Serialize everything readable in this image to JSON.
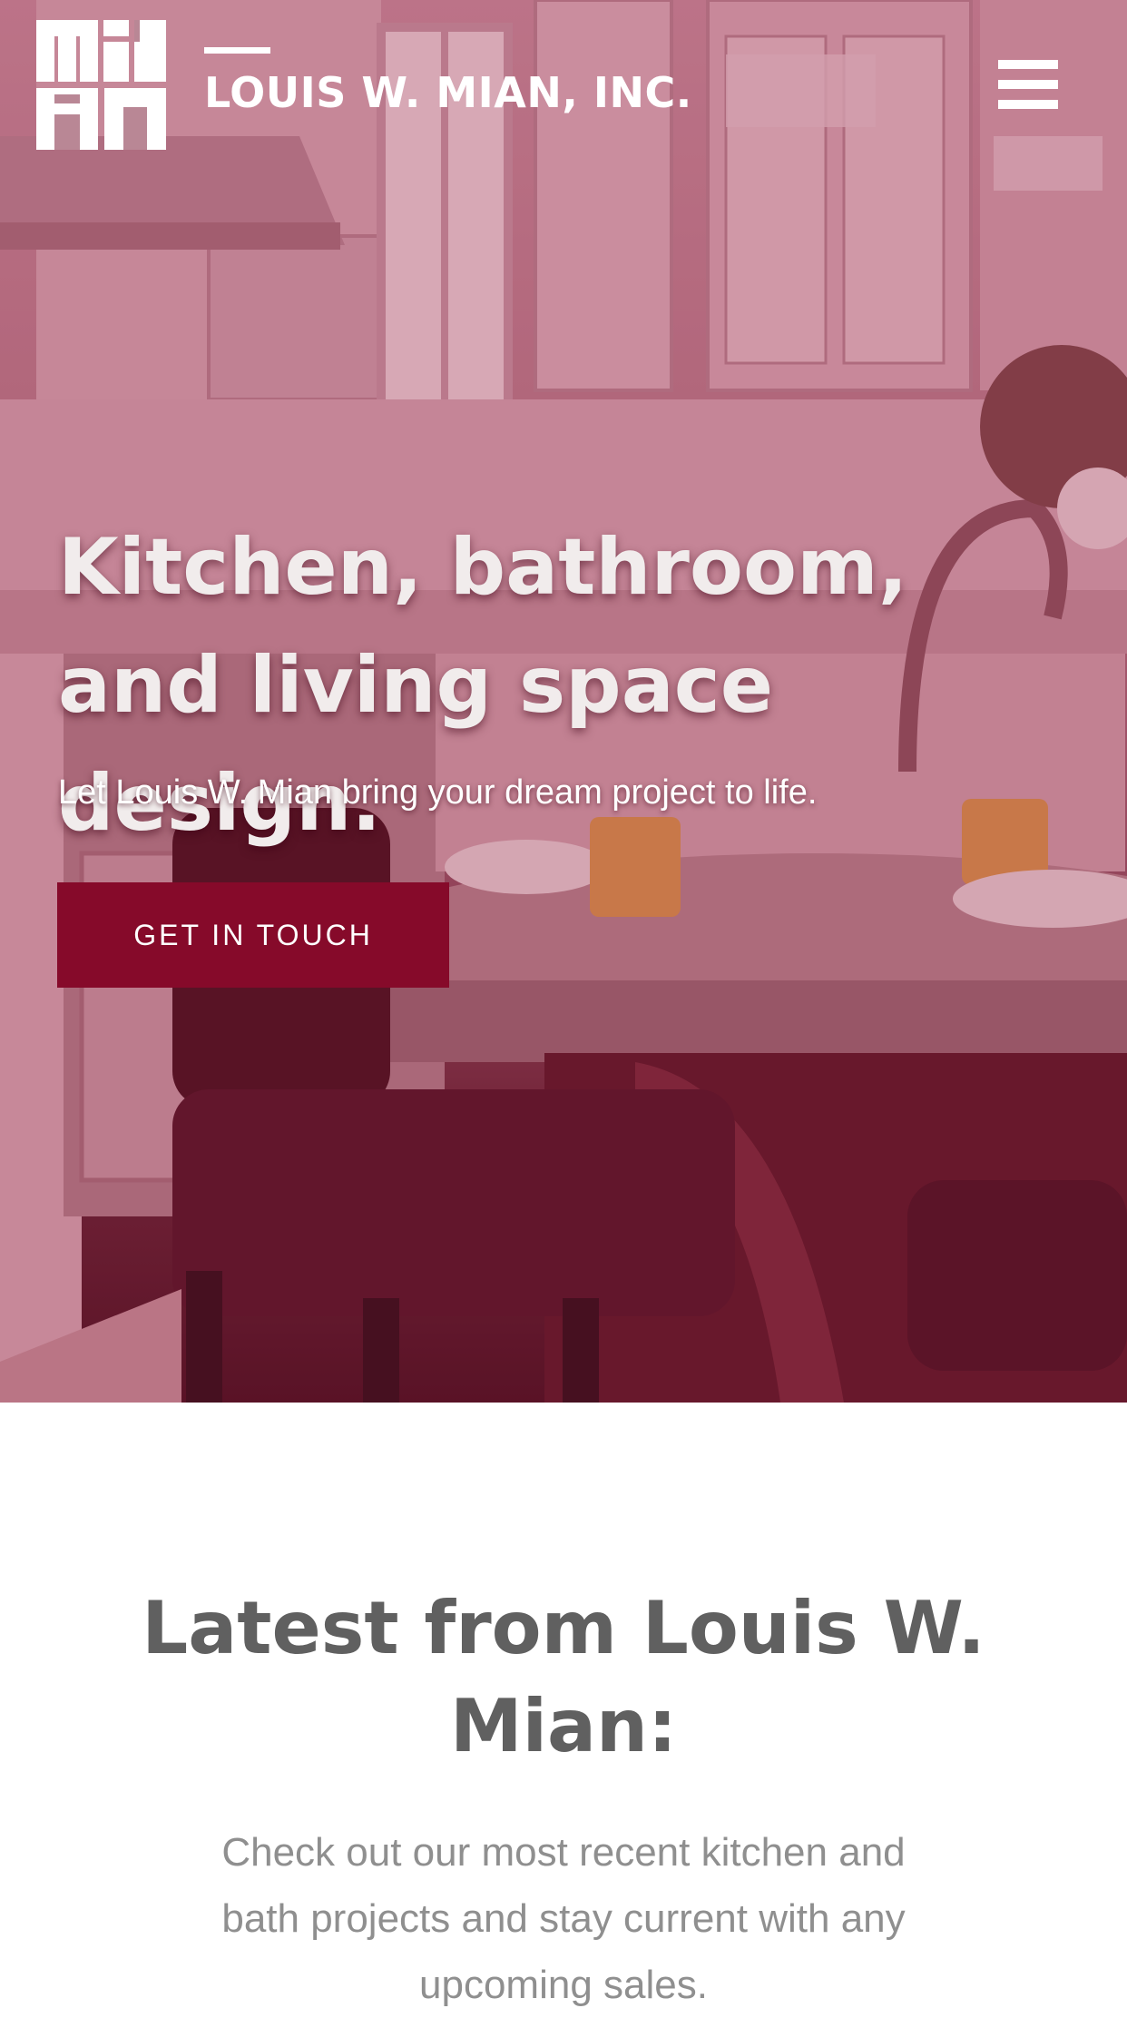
{
  "header": {
    "brand_name": "LOUIS W. MIAN, INC.",
    "logo_text": "MIAN",
    "menu_icon": "hamburger-menu-icon"
  },
  "hero": {
    "title": "Kitchen, bathroom, and living space design.",
    "subtitle": "Let Louis W. Mian bring your dream project to life.",
    "cta_label": "GET IN TOUCH",
    "cta_color": "#860a2a"
  },
  "latest": {
    "title": "Latest from Louis W. Mian:",
    "subtitle": "Check out our most recent kitchen and bath projects and stay current with any upcoming sales."
  }
}
